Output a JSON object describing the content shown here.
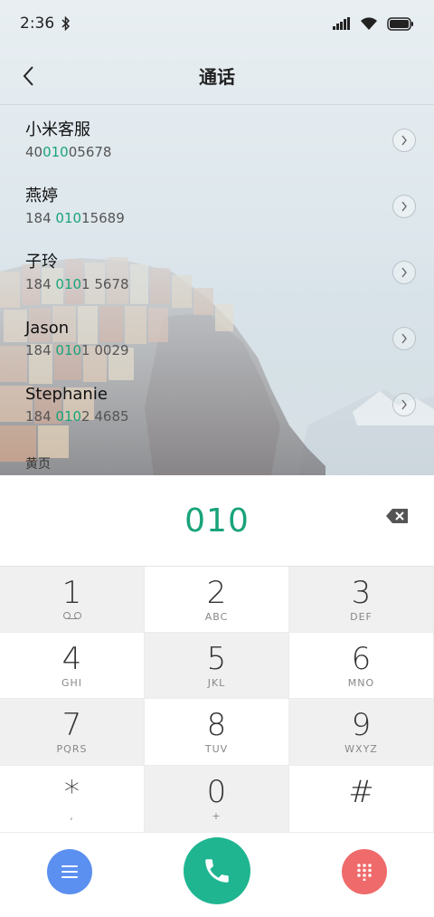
{
  "status_bar": {
    "time": "2:36"
  },
  "header": {
    "title": "通话"
  },
  "contacts": [
    {
      "name": "小米客服",
      "num_pre": "40",
      "num_hl": "010",
      "num_post": "05678"
    },
    {
      "name": "燕婷",
      "num_pre": "184 ",
      "num_hl": "010",
      "num_post": "15689"
    },
    {
      "name": "子玲",
      "num_pre": "184 ",
      "num_hl": "010",
      "num_post": "1 5678"
    },
    {
      "name": "Jason",
      "num_pre": "184 ",
      "num_hl": "010",
      "num_post": "1 0029"
    },
    {
      "name": "Stephanie",
      "num_pre": "184 ",
      "num_hl": "010",
      "num_post": "2 4685"
    }
  ],
  "yellow_pages": "黄页",
  "input": {
    "value": "010"
  },
  "keypad": [
    {
      "digit": "1",
      "letters": ""
    },
    {
      "digit": "2",
      "letters": "ABC"
    },
    {
      "digit": "3",
      "letters": "DEF"
    },
    {
      "digit": "4",
      "letters": "GHI"
    },
    {
      "digit": "5",
      "letters": "JKL"
    },
    {
      "digit": "6",
      "letters": "MNO"
    },
    {
      "digit": "7",
      "letters": "PQRS"
    },
    {
      "digit": "8",
      "letters": "TUV"
    },
    {
      "digit": "9",
      "letters": "WXYZ"
    },
    {
      "digit": "*",
      "letters": ","
    },
    {
      "digit": "0",
      "letters": "+"
    },
    {
      "digit": "#",
      "letters": ""
    }
  ],
  "colors": {
    "accent": "#19a37a",
    "call": "#1fb591",
    "menu": "#5b8ff0",
    "dialpad": "#ef6a6a"
  },
  "icons": {
    "back": "chevron-left-icon",
    "voicemail": "voicemail-icon",
    "backspace": "backspace-icon",
    "menu": "menu-icon",
    "call": "phone-icon",
    "dialpad": "dialpad-icon"
  }
}
